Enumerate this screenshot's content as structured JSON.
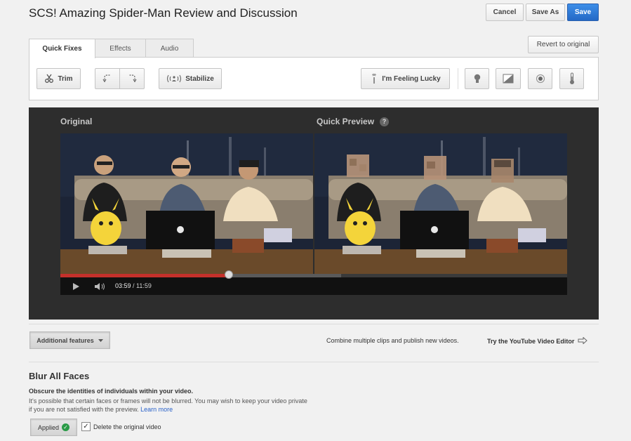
{
  "header": {
    "title": "SCS! Amazing Spider-Man Review and Discussion",
    "cancel_label": "Cancel",
    "save_as_label": "Save As",
    "save_label": "Save",
    "revert_label": "Revert to original"
  },
  "tabs": [
    {
      "label": "Quick Fixes",
      "active": true
    },
    {
      "label": "Effects",
      "active": false
    },
    {
      "label": "Audio",
      "active": false
    }
  ],
  "tools": {
    "trim_label": "Trim",
    "stabilize_label": "Stabilize",
    "lucky_label": "I'm Feeling Lucky"
  },
  "preview": {
    "original_label": "Original",
    "quick_preview_label": "Quick Preview",
    "help_glyph": "?",
    "current_time": "03:59",
    "separator": " / ",
    "duration": "11:59",
    "progress_fraction": 0.333
  },
  "features": {
    "additional_label": "Additional features",
    "combine_text": "Combine multiple clips and publish new videos.",
    "try_editor_label": "Try the YouTube Video Editor"
  },
  "blur": {
    "title": "Blur All Faces",
    "desc_bold": "Obscure the identities of individuals within your video.",
    "desc_text": "It's possible that certain faces or frames will not be blurred. You may wish to keep your video private if you are not satisfied with the preview.",
    "learn_more": "Learn more",
    "applied_label": "Applied",
    "delete_label": "Delete the original video",
    "delete_checked": true
  },
  "colors": {
    "accent_blue": "#2a6dd0",
    "progress_red": "#c4302b",
    "applied_green": "#2a9b47"
  }
}
